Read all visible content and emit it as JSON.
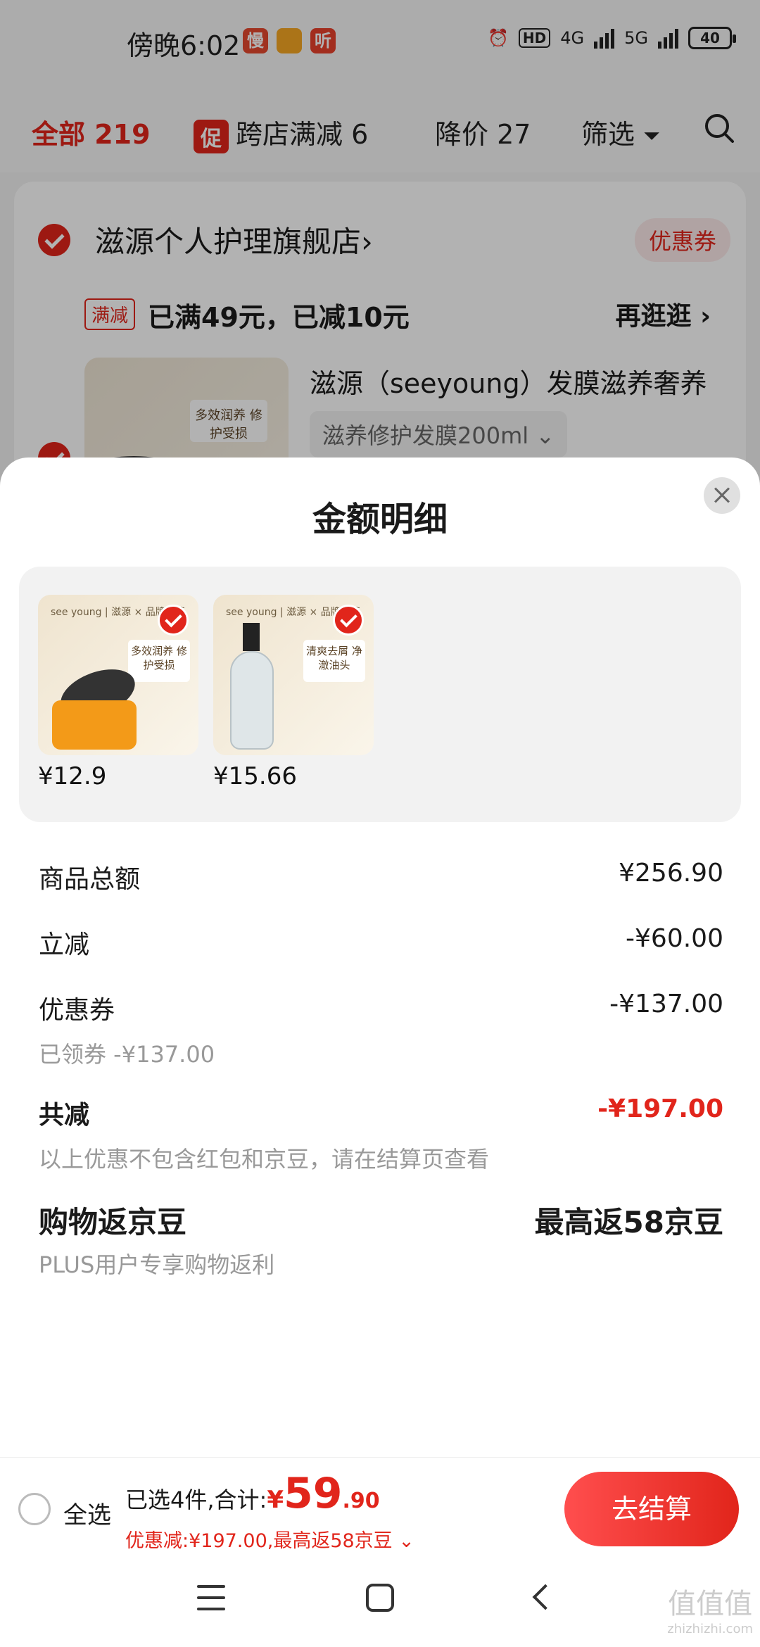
{
  "status": {
    "time": "傍晚6:02",
    "apps": [
      "慢",
      "",
      "听"
    ],
    "hd": "HD",
    "net1": "4G",
    "net2": "5G",
    "battery": "40"
  },
  "tabs": {
    "all": "全部 219",
    "promo_badge": "促",
    "promo": "跨店满减 6",
    "price_drop": "降价 27",
    "filter": "筛选"
  },
  "store": {
    "name": "滋源个人护理旗舰店",
    "name_chevron": "›",
    "coupon": "优惠券",
    "man_tag": "满减",
    "man_text": "已满49元，已减10元",
    "stroll": "再逛逛 ›",
    "product_title": "滋源（seeyoung）发膜滋养奢养",
    "product_spec": "滋养修护发膜200ml ⌄",
    "thumb_text": "多效润养 修护受损"
  },
  "sheet": {
    "title": "金额明细",
    "items": [
      {
        "price": "¥12.9",
        "label": "see young | 滋源 × 品牌直营",
        "badge": "多效润养 修护受损"
      },
      {
        "price": "¥15.66",
        "label": "see young | 滋源 × 品牌直营",
        "badge": "清爽去屑 净澈油头"
      }
    ],
    "rows": {
      "total_label": "商品总额",
      "total_value": "¥256.90",
      "instant_label": "立减",
      "instant_value": "-¥60.00",
      "coupon_label": "优惠券",
      "coupon_value": "-¥137.00",
      "coupon_sub": "已领券 -¥137.00",
      "sum_label": "共减",
      "sum_value": "-¥197.00",
      "sum_sub": "以上优惠不包含红包和京豆，请在结算页查看",
      "bean_label": "购物返京豆",
      "bean_value": "最高返58京豆",
      "bean_sub": "PLUS用户专享购物返利"
    }
  },
  "checkout": {
    "select_all": "全选",
    "selected": "已选4件,合计:",
    "yen": "¥",
    "total_int": "59",
    "total_dec": ".90",
    "sub": "优惠减:¥197.00,最高返58京豆 ⌄",
    "button": "去结算"
  },
  "watermark": {
    "main": "值值值",
    "sub": "zhizhizhi.com"
  },
  "colors": {
    "accent": "#e1251b",
    "sheet_bg": "#ffffff",
    "box_bg": "#f2f2f2"
  }
}
